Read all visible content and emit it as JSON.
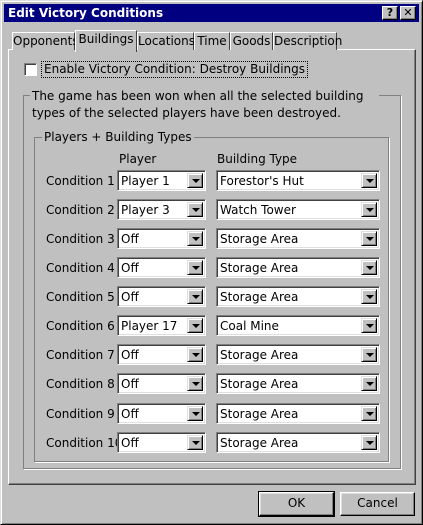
{
  "window": {
    "title": "Edit Victory Conditions",
    "help_label": "?",
    "close_label": "✕"
  },
  "tabs": [
    {
      "label": "Opponents"
    },
    {
      "label": "Buildings"
    },
    {
      "label": "Locations"
    },
    {
      "label": "Time"
    },
    {
      "label": "Goods"
    },
    {
      "label": "Description"
    }
  ],
  "active_tab": "Buildings",
  "enable_checkbox": {
    "label": "Enable Victory Condition: Destroy Buildings",
    "checked": false
  },
  "description": "The game has been won when all the selected building types of the selected players have been destroyed.",
  "group": {
    "title": "Players + Building Types",
    "player_header": "Player",
    "building_header": "Building Type"
  },
  "conditions": [
    {
      "label": "Condition 1",
      "player": "Player 1",
      "building": "Forestor's Hut"
    },
    {
      "label": "Condition 2",
      "player": "Player 3",
      "building": "Watch Tower"
    },
    {
      "label": "Condition 3",
      "player": "Off",
      "building": "Storage Area"
    },
    {
      "label": "Condition 4",
      "player": "Off",
      "building": "Storage Area"
    },
    {
      "label": "Condition 5",
      "player": "Off",
      "building": "Storage Area"
    },
    {
      "label": "Condition 6",
      "player": "Player 17",
      "building": "Coal Mine"
    },
    {
      "label": "Condition 7",
      "player": "Off",
      "building": "Storage Area"
    },
    {
      "label": "Condition 8",
      "player": "Off",
      "building": "Storage Area"
    },
    {
      "label": "Condition 9",
      "player": "Off",
      "building": "Storage Area"
    },
    {
      "label": "Condition 10",
      "player": "Off",
      "building": "Storage Area"
    }
  ],
  "buttons": {
    "ok": "OK",
    "cancel": "Cancel"
  }
}
